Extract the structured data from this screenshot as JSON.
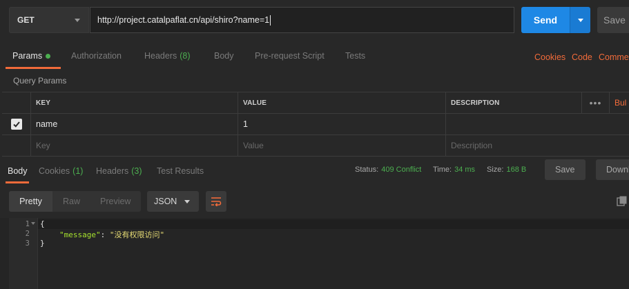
{
  "request": {
    "method": "GET",
    "url": "http://project.catalpaflat.cn/api/shiro?name=1",
    "send_label": "Send",
    "save_label": "Save"
  },
  "request_tabs": {
    "params": "Params",
    "authorization": "Authorization",
    "headers": "Headers",
    "headers_count": "(8)",
    "body": "Body",
    "prerequest": "Pre-request Script",
    "tests": "Tests",
    "cookies": "Cookies",
    "code": "Code",
    "comments": "Comme"
  },
  "query_params": {
    "title": "Query Params",
    "columns": [
      "KEY",
      "VALUE",
      "DESCRIPTION"
    ],
    "bulk_label": "Bul",
    "rows": [
      {
        "checked": true,
        "key": "name",
        "value": "1",
        "description": ""
      }
    ],
    "placeholders": {
      "key": "Key",
      "value": "Value",
      "description": "Description"
    }
  },
  "response_tabs": {
    "body": "Body",
    "cookies": "Cookies",
    "cookies_count": "(1)",
    "headers": "Headers",
    "headers_count": "(3)",
    "test_results": "Test Results"
  },
  "response_status": {
    "status_label": "Status:",
    "status_value": "409 Conflict",
    "time_label": "Time:",
    "time_value": "34 ms",
    "size_label": "Size:",
    "size_value": "168 B",
    "save_label": "Save",
    "download_label": "Downl"
  },
  "format_bar": {
    "pretty": "Pretty",
    "raw": "Raw",
    "preview": "Preview",
    "json": "JSON"
  },
  "code": {
    "line_numbers": [
      "1",
      "2",
      "3"
    ],
    "line1": "{",
    "key": "\"message\"",
    "colon": ": ",
    "value": "\"没有权限访问\"",
    "line3": "}"
  },
  "colors": {
    "accent": "#f26b3a",
    "send": "#1e88e5",
    "success": "#4caf50"
  }
}
